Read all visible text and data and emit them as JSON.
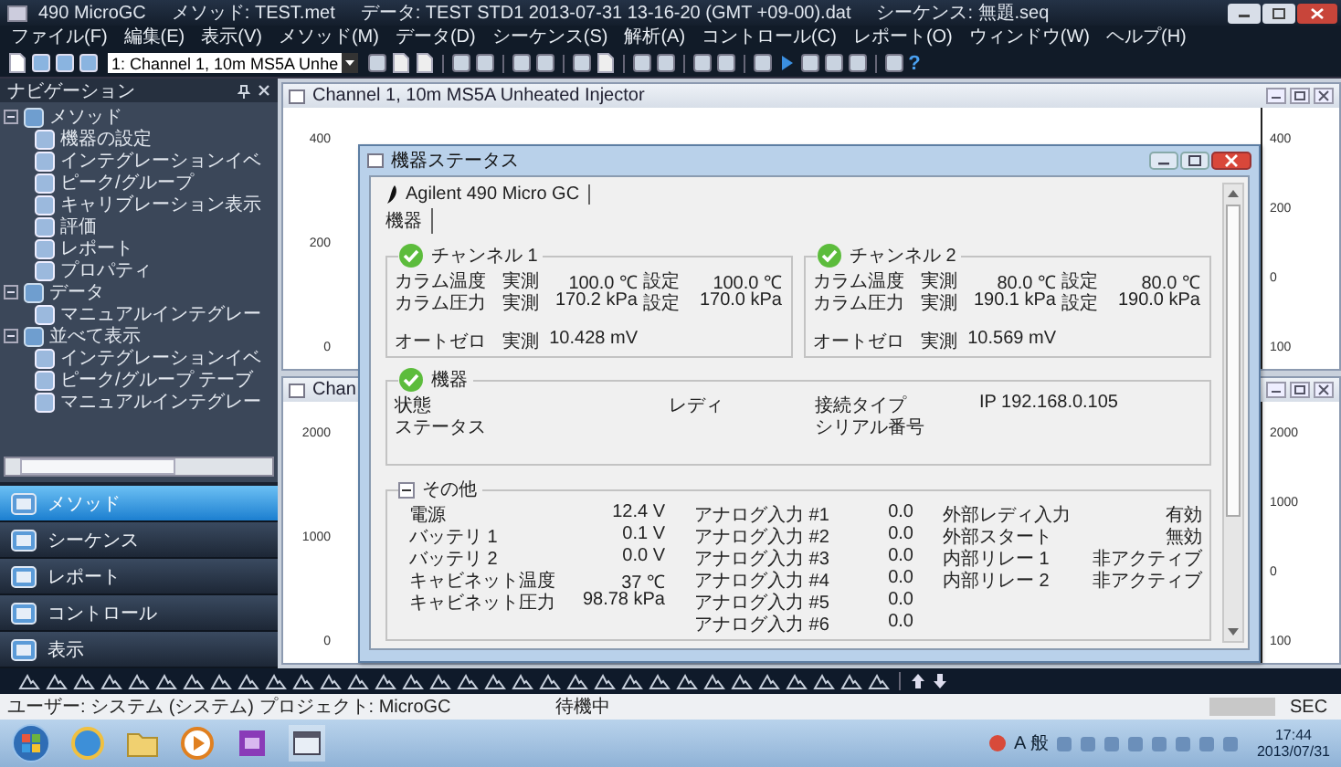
{
  "window": {
    "title_parts": [
      "490 MicroGC",
      "メソッド: TEST.met",
      "データ: TEST STD1 2013-07-31 13-16-20 (GMT +09-00).dat",
      "シーケンス: 無題.seq"
    ]
  },
  "menu": [
    "ファイル(F)",
    "編集(E)",
    "表示(V)",
    "メソッド(M)",
    "データ(D)",
    "シーケンス(S)",
    "解析(A)",
    "コントロール(C)",
    "レポート(O)",
    "ウィンドウ(W)",
    "ヘルプ(H)"
  ],
  "toolbar": {
    "channel_combo": "1: Channel 1, 10m MS5A Unhe",
    "help_glyph": "?"
  },
  "navigation": {
    "title": "ナビゲーション",
    "tree": [
      {
        "label": "メソッド",
        "expanded": true,
        "children": [
          {
            "label": "機器の設定"
          },
          {
            "label": "インテグレーションイベ"
          },
          {
            "label": "ピーク/グループ"
          },
          {
            "label": "キャリブレーション表示"
          },
          {
            "label": "評価"
          },
          {
            "label": "レポート"
          },
          {
            "label": "プロパティ"
          }
        ]
      },
      {
        "label": "データ",
        "expanded": true,
        "children": [
          {
            "label": "マニュアルインテグレー"
          }
        ]
      },
      {
        "label": "並べて表示",
        "expanded": true,
        "children": [
          {
            "label": "インテグレーションイベ"
          },
          {
            "label": "ピーク/グループ テーブ"
          },
          {
            "label": "マニュアルインテグレー"
          }
        ]
      }
    ],
    "buttons": [
      {
        "label": "メソッド",
        "selected": true
      },
      {
        "label": "シーケンス",
        "selected": false
      },
      {
        "label": "レポート",
        "selected": false
      },
      {
        "label": "コントロール",
        "selected": false
      },
      {
        "label": "表示",
        "selected": false
      }
    ]
  },
  "chart_windows": [
    {
      "title": "Channel 1, 10m MS5A Unheated Injector",
      "left_ticks": [
        "400",
        "200",
        "0"
      ],
      "right_ticks": [
        "400",
        "200",
        "0",
        "100"
      ]
    },
    {
      "title": "Chan",
      "left_ticks": [
        "2000",
        "1000",
        "0"
      ],
      "right_ticks": [
        "2000",
        "1000",
        "0",
        "100"
      ]
    }
  ],
  "dialog": {
    "title": "機器ステータス",
    "device_tab": "Agilent 490 Micro GC",
    "sub_tab": "機器",
    "channels": [
      {
        "title": "チャンネル 1",
        "ok": true,
        "rows": [
          {
            "label": "カラム温度",
            "actual_label": "実測",
            "actual": "100.0 ℃",
            "set_label": "設定",
            "set": "100.0 ℃"
          },
          {
            "label": "カラム圧力",
            "actual_label": "実測",
            "actual": "170.2 kPa",
            "set_label": "設定",
            "set": "170.0 kPa"
          },
          {
            "label": "オートゼロ",
            "actual_label": "実測",
            "actual": "10.428 mV"
          }
        ]
      },
      {
        "title": "チャンネル 2",
        "ok": true,
        "rows": [
          {
            "label": "カラム温度",
            "actual_label": "実測",
            "actual": "80.0 ℃",
            "set_label": "設定",
            "set": "80.0 ℃"
          },
          {
            "label": "カラム圧力",
            "actual_label": "実測",
            "actual": "190.1 kPa",
            "set_label": "設定",
            "set": "190.0 kPa"
          },
          {
            "label": "オートゼロ",
            "actual_label": "実測",
            "actual": "10.569 mV"
          }
        ]
      }
    ],
    "instrument": {
      "title": "機器",
      "ok": true,
      "rows": [
        {
          "label": "状態",
          "value": "レディ",
          "label2": "接続タイプ",
          "value2": "IP 192.168.0.105"
        },
        {
          "label": "ステータス",
          "label2": "シリアル番号"
        }
      ]
    },
    "other": {
      "title": "その他",
      "expanded": true,
      "columns": [
        [
          {
            "label": "電源",
            "value": "12.4 V"
          },
          {
            "label": "バッテリ 1",
            "value": "0.1 V"
          },
          {
            "label": "バッテリ 2",
            "value": "0.0 V"
          },
          {
            "label": "キャビネット温度",
            "value": "37 ℃"
          },
          {
            "label": "キャビネット圧力",
            "value": "98.78 kPa"
          }
        ],
        [
          {
            "label": "アナログ入力 #1",
            "value": "0.0"
          },
          {
            "label": "アナログ入力 #2",
            "value": "0.0"
          },
          {
            "label": "アナログ入力 #3",
            "value": "0.0"
          },
          {
            "label": "アナログ入力 #4",
            "value": "0.0"
          },
          {
            "label": "アナログ入力 #5",
            "value": "0.0"
          },
          {
            "label": "アナログ入力 #6",
            "value": "0.0"
          }
        ],
        [
          {
            "label": "外部レディ入力",
            "value": "有効"
          },
          {
            "label": "外部スタート",
            "value": "無効"
          },
          {
            "label": "内部リレー 1",
            "value": "非アクティブ"
          },
          {
            "label": "内部リレー 2",
            "value": "非アクティブ"
          }
        ]
      ]
    }
  },
  "status_bar": {
    "user": "ユーザー: システム (システム) プロジェクト: MicroGC",
    "state": "待機中",
    "unit": "SEC"
  },
  "taskbar": {
    "ime": "A 般",
    "time": "17:44",
    "date": "2013/07/31"
  }
}
